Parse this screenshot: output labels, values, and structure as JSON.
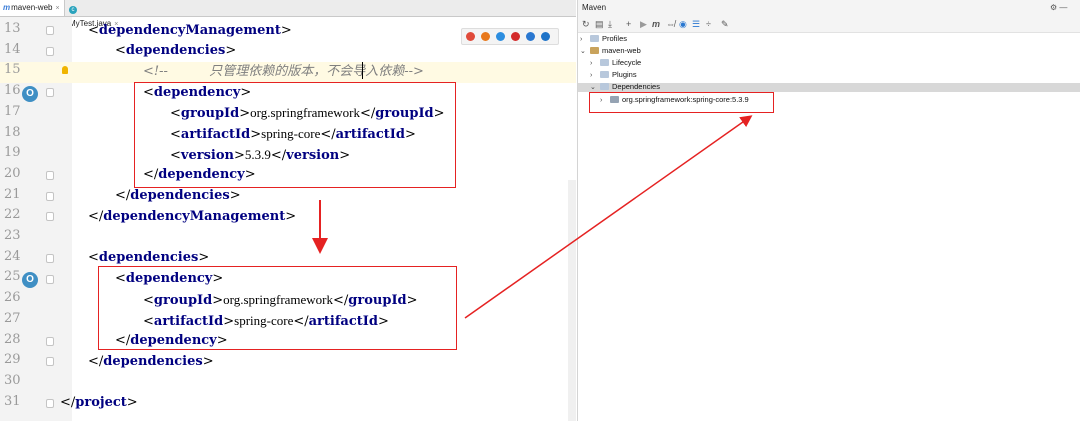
{
  "tabs": [
    {
      "label": "maven-web",
      "icon": "maven-m-icon",
      "active": true
    },
    {
      "label": "MyTest.java",
      "icon": "java-class-icon",
      "active": false
    }
  ],
  "browser_icons": [
    "chrome-icon",
    "firefox-icon",
    "safari-icon",
    "opera-icon",
    "ie-icon",
    "edge-icon"
  ],
  "lines": [
    {
      "num": "13",
      "indent": 0
    },
    {
      "num": "14",
      "indent": 1
    },
    {
      "num": "15",
      "indent": 2,
      "comment_text": "只管理依赖的版本，不会导入依赖"
    },
    {
      "num": "16",
      "indent": 2
    },
    {
      "num": "17",
      "indent": 3,
      "tag": "groupId",
      "value": "org.springframework"
    },
    {
      "num": "18",
      "indent": 3,
      "tag": "artifactId",
      "value": "spring-core"
    },
    {
      "num": "19",
      "indent": 3,
      "tag": "version",
      "value": "5.3.9"
    },
    {
      "num": "20",
      "indent": 2
    },
    {
      "num": "21",
      "indent": 1
    },
    {
      "num": "22",
      "indent": 0
    },
    {
      "num": "23",
      "indent": 0
    },
    {
      "num": "24",
      "indent": 0
    },
    {
      "num": "25",
      "indent": 1
    },
    {
      "num": "26",
      "indent": 2,
      "tag": "groupId",
      "value": "org.springframework"
    },
    {
      "num": "27",
      "indent": 2,
      "tag": "artifactId",
      "value": "spring-core"
    },
    {
      "num": "28",
      "indent": 1
    },
    {
      "num": "29",
      "indent": 0
    },
    {
      "num": "30",
      "indent": 0
    },
    {
      "num": "31",
      "indent": 0
    }
  ],
  "code": {
    "dependencyManagement": "dependencyManagement",
    "dependencies": "dependencies",
    "dependency": "dependency",
    "project": "project",
    "groupId": "groupId",
    "artifactId": "artifactId",
    "version": "version",
    "group_value": "org.springframework",
    "artifact_value": "spring-core",
    "version_value": "5.3.9",
    "comment_open": "<!--",
    "comment_text": "只管理依赖的版本，不会导入依赖",
    "comment_close": "-->"
  },
  "maven": {
    "title": "Maven",
    "toolbar": [
      "refresh-icon",
      "generate-sources-icon",
      "download-icon",
      "add-icon",
      "run-icon",
      "m-execute-icon",
      "toggle-offline-icon",
      "skip-tests-icon",
      "show-dependencies-icon",
      "collapse-icon",
      "settings-wrench-icon"
    ],
    "tree": [
      {
        "label": "Profiles",
        "level": 0,
        "expanded": false
      },
      {
        "label": "maven-web",
        "level": 0,
        "expanded": true
      },
      {
        "label": "Lifecycle",
        "level": 1,
        "expanded": false
      },
      {
        "label": "Plugins",
        "level": 1,
        "expanded": false
      },
      {
        "label": "Dependencies",
        "level": 1,
        "expanded": true
      },
      {
        "label": "org.springframework:spring-core:5.3.9",
        "level": 2,
        "expanded": false
      }
    ]
  },
  "colors": {
    "annotation_red": "#e52222",
    "tag_blue": "#000080",
    "comment_gray": "#808080"
  }
}
